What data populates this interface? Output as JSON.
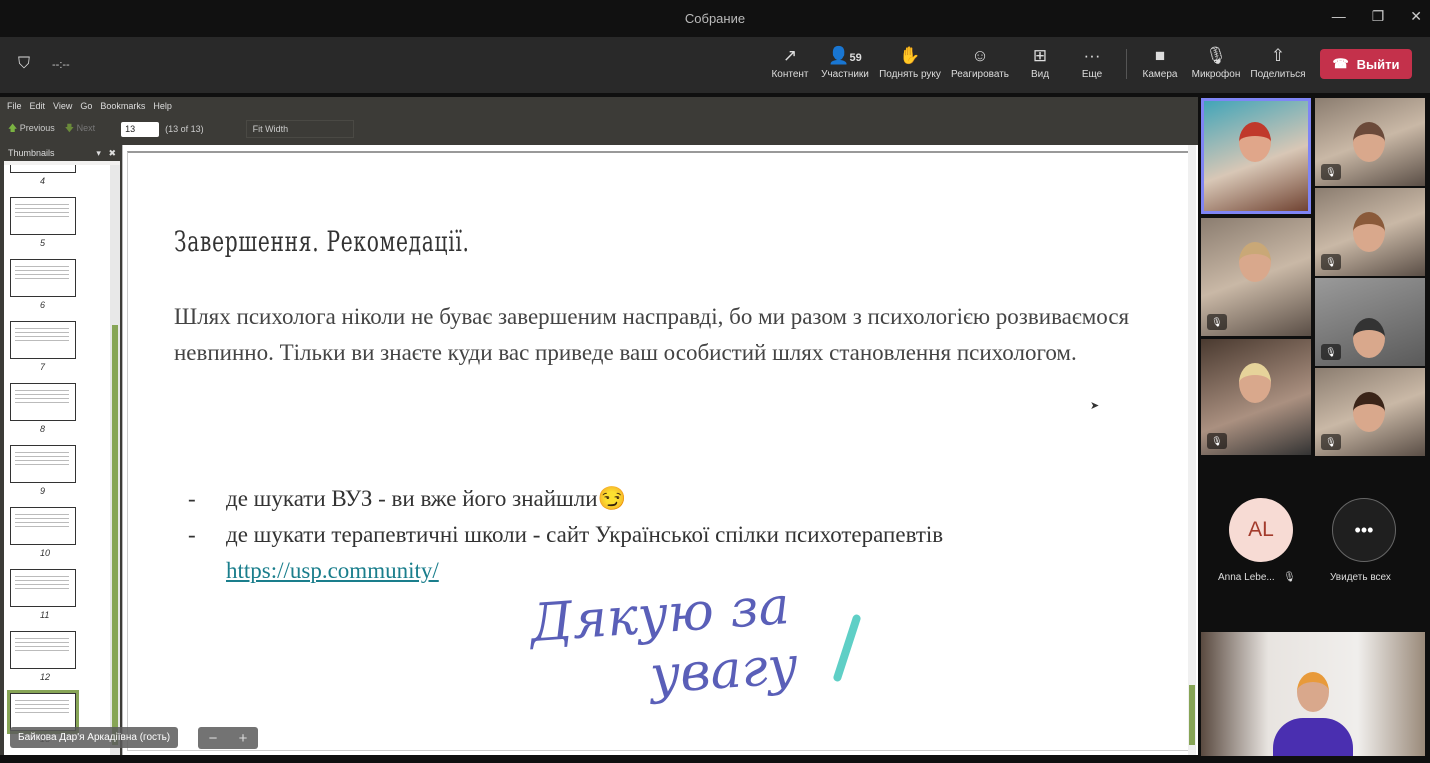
{
  "window": {
    "title": "Собрание",
    "controls": [
      "—",
      "❐",
      "✕"
    ]
  },
  "meeting": {
    "timer": "--:--",
    "participant_count": "59",
    "buttons": [
      {
        "label": "Контент",
        "icon": "↗"
      },
      {
        "label": "Участники",
        "icon": "👤"
      },
      {
        "label": "Поднять руку",
        "icon": "✋"
      },
      {
        "label": "Реагировать",
        "icon": "☺"
      },
      {
        "label": "Вид",
        "icon": "⊞"
      },
      {
        "label": "Еще",
        "icon": "···"
      },
      {
        "label": "Камера",
        "icon": "■"
      },
      {
        "label": "Микрофон",
        "icon": "🎙"
      },
      {
        "label": "Поделиться",
        "icon": "⇧"
      }
    ],
    "leave_label": "Выйти",
    "leave_color": "#c4314b"
  },
  "viewer": {
    "menu": [
      "File",
      "Edit",
      "View",
      "Go",
      "Bookmarks",
      "Help"
    ],
    "previous": "Previous",
    "next": "Next",
    "page": "13",
    "page_of": "(13 of 13)",
    "zoom": "Fit Width",
    "sidebar_title": "Thumbnails",
    "thumbnails": [
      "4",
      "5",
      "6",
      "7",
      "8",
      "9",
      "10",
      "11",
      "12",
      "13"
    ]
  },
  "slide": {
    "title": "Завершення. Рекомедації.",
    "paragraph": "Шлях психолога ніколи не буває завершеним насправді, бо ми разом з психологією розвиваємося невпинно. Тільки ви знаєте куди вас приведе ваш особистий шлях становлення психологом.",
    "bullet1": "де шукати ВУЗ - ви вже його знайшли😏",
    "bullet2": "де шукати терапевтичні школи - сайт Української спілки психотерапевтів",
    "link": "https://usp.community/",
    "thanks_line1": "Дякую за",
    "thanks_line2": "увагу"
  },
  "presenter_name": "Байкова Дар'я Аркадіївна (гость)",
  "zoom_controls": {
    "minus": "−",
    "plus": "+"
  },
  "gallery": {
    "avatar_initials": "AL",
    "avatar_name": "Anna Lebe...",
    "see_all": "Увидеть всех"
  }
}
